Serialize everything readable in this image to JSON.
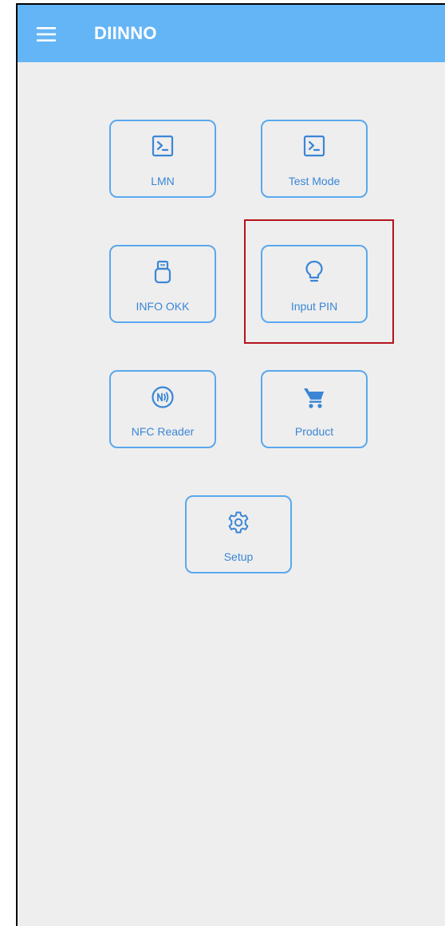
{
  "app": {
    "title": "DIINNO"
  },
  "icons": {
    "menu": "hamburger-menu-icon",
    "lmn": "terminal-icon",
    "test_mode": "terminal-icon",
    "info_okk": "usb-drive-icon",
    "input_pin": "lightbulb-icon",
    "nfc_reader": "nfc-icon",
    "product": "shopping-cart-icon",
    "setup": "gear-icon"
  },
  "tiles": {
    "lmn": "LMN",
    "test_mode": "Test Mode",
    "info_okk": "INFO OKK",
    "input_pin": "Input PIN",
    "nfc_reader": "NFC Reader",
    "product": "Product",
    "setup": "Setup"
  },
  "colors": {
    "appbar": "#64b5f6",
    "accent": "#3a86d6",
    "tile_border": "#5aa8ee",
    "background": "#eeeeee",
    "highlight": "#b3141c"
  }
}
